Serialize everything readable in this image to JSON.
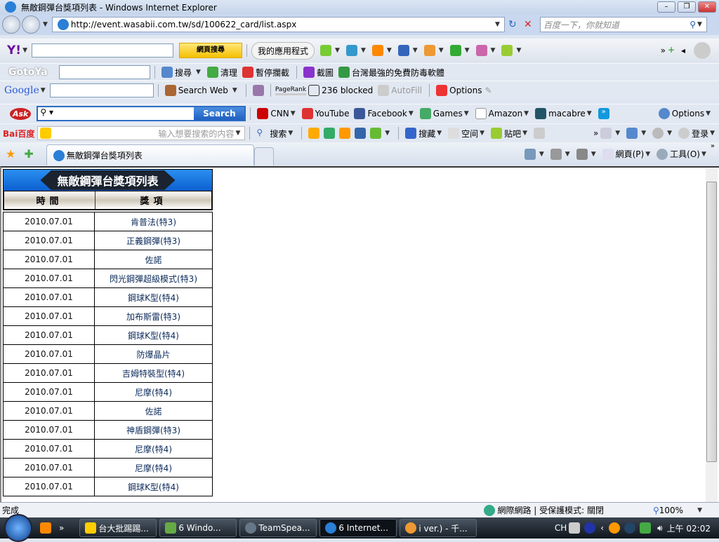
{
  "window": {
    "title": "無敵鋼彈台獎項列表 - Windows Internet Explorer",
    "url": "http://event.wasabii.com.tw/sd/100622_card/list.aspx",
    "search_placeholder": "百度一下，你就知道"
  },
  "yahoo": {
    "search_button": "網頁搜尋",
    "apps": "我的應用程式"
  },
  "gotoya": {
    "logo": "GotoYa",
    "search": "搜尋",
    "clean": "清理",
    "block": "暫停攔截",
    "capture": "截圖",
    "antivirus": "台灣最強的免費防毒軟體"
  },
  "google": {
    "logo": "Google",
    "search_web": "Search Web",
    "pagerank": "PageRank",
    "blocked": "236 blocked",
    "autofill": "AutoFill",
    "options": "Options"
  },
  "ask": {
    "logo": "Ask",
    "search_button": "Search",
    "links": [
      "CNN",
      "YouTube",
      "Facebook",
      "Games",
      "Amazon",
      "macabre"
    ],
    "options": "Options"
  },
  "baidu": {
    "logo": "Bai百度",
    "placeholder": "输入想要搜索的内容",
    "search": "搜索",
    "collect": "搜藏",
    "space": "空间",
    "tieba": "贴吧",
    "login": "登录"
  },
  "tabs": {
    "active": "無敵鋼彈台獎項列表",
    "page_menu": "網頁(P)",
    "tools_menu": "工具(O)"
  },
  "table": {
    "title": "無敵鋼彈台獎項列表",
    "headers": [
      "時間",
      "獎項"
    ],
    "rows": [
      [
        "2010.07.01",
        "肯普法(特3)"
      ],
      [
        "2010.07.01",
        "正義鋼彈(特3)"
      ],
      [
        "2010.07.01",
        "佐諾"
      ],
      [
        "2010.07.01",
        "閃光鋼彈超級模式(特3)"
      ],
      [
        "2010.07.01",
        "鋼球K型(特4)"
      ],
      [
        "2010.07.01",
        "加布斯雷(特3)"
      ],
      [
        "2010.07.01",
        "鋼球K型(特4)"
      ],
      [
        "2010.07.01",
        "防爆晶片"
      ],
      [
        "2010.07.01",
        "吉姆特裝型(特4)"
      ],
      [
        "2010.07.01",
        "尼摩(特4)"
      ],
      [
        "2010.07.01",
        "佐諾"
      ],
      [
        "2010.07.01",
        "神盾鋼彈(特3)"
      ],
      [
        "2010.07.01",
        "尼摩(特4)"
      ],
      [
        "2010.07.01",
        "尼摩(特4)"
      ],
      [
        "2010.07.01",
        "鋼球K型(特4)"
      ]
    ]
  },
  "status": {
    "text": "完成",
    "zone": "網際網路 | 受保護模式: 關閉",
    "zoom": "100%"
  },
  "taskbar": {
    "tasks": [
      "台大批踢踢...",
      "6 Windo...",
      "TeamSpea...",
      "6 Internet...",
      "i ver.) - 千..."
    ],
    "lang": "CH",
    "clock": "上午 02:02"
  }
}
